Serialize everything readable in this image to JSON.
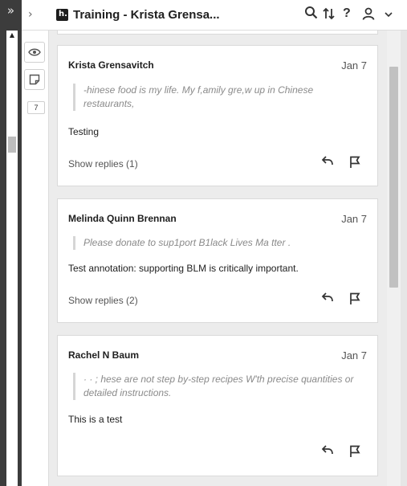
{
  "browser": {
    "expand_glyph": "»"
  },
  "header": {
    "collapse_glyph": "›",
    "logo_letter": "h.",
    "group_title": "Training - Krista Grensa...",
    "icons": [
      "search-icon",
      "sort-icon",
      "help-icon",
      "user-icon",
      "chevron-down-icon"
    ],
    "help_glyph": "?"
  },
  "tools": {
    "annotation_count": "7"
  },
  "annotations": [
    {
      "author": "Krista Grensavitch",
      "date": "Jan 7",
      "quote": "-hinese food is my life. My f,amily gre,w up in Chinese restaurants,",
      "text": "Testing",
      "replies_label": "Show replies (1)"
    },
    {
      "author": "Melinda Quinn Brennan",
      "date": "Jan 7",
      "quote": "Please donate to sup1port B1lack Lives Ma tter .",
      "text": "Test annotation: supporting BLM is critically important.",
      "replies_label": "Show replies (2)"
    },
    {
      "author": "Rachel N Baum",
      "date": "Jan 7",
      "quote": "· · ; hese are not step by-step recipes W'th precise quantities or detailed instructions.",
      "text": "This is a test",
      "replies_label": ""
    }
  ]
}
